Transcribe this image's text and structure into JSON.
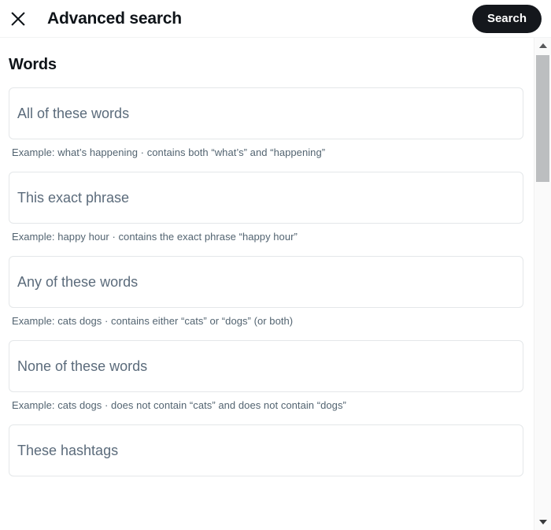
{
  "header": {
    "close_icon": "close-icon",
    "title": "Advanced search",
    "search_label": "Search"
  },
  "section": {
    "title": "Words"
  },
  "fields": [
    {
      "name": "all-of-these-words",
      "value": "",
      "placeholder": "All of these words",
      "hint": "Example: what’s happening · contains both “what’s” and “happening”"
    },
    {
      "name": "this-exact-phrase",
      "value": "",
      "placeholder": "This exact phrase",
      "hint": "Example: happy hour · contains the exact phrase “happy hour”"
    },
    {
      "name": "any-of-these-words",
      "value": "",
      "placeholder": "Any of these words",
      "hint": "Example: cats dogs · contains either “cats” or “dogs” (or both)"
    },
    {
      "name": "none-of-these-words",
      "value": "",
      "placeholder": "None of these words",
      "hint": "Example: cats dogs · does not contain “cats” and does not contain “dogs”"
    },
    {
      "name": "these-hashtags",
      "value": "",
      "placeholder": "These hashtags",
      "hint": ""
    }
  ],
  "scrollbar": {
    "up_arrow_icon": "triangle-up-icon",
    "down_arrow_icon": "triangle-down-icon"
  },
  "colors": {
    "text_primary": "#0f1419",
    "text_secondary": "#536471",
    "button_bg": "#14171c",
    "border": "#e4e7e9",
    "scrollbar_thumb": "#bcbec0"
  }
}
